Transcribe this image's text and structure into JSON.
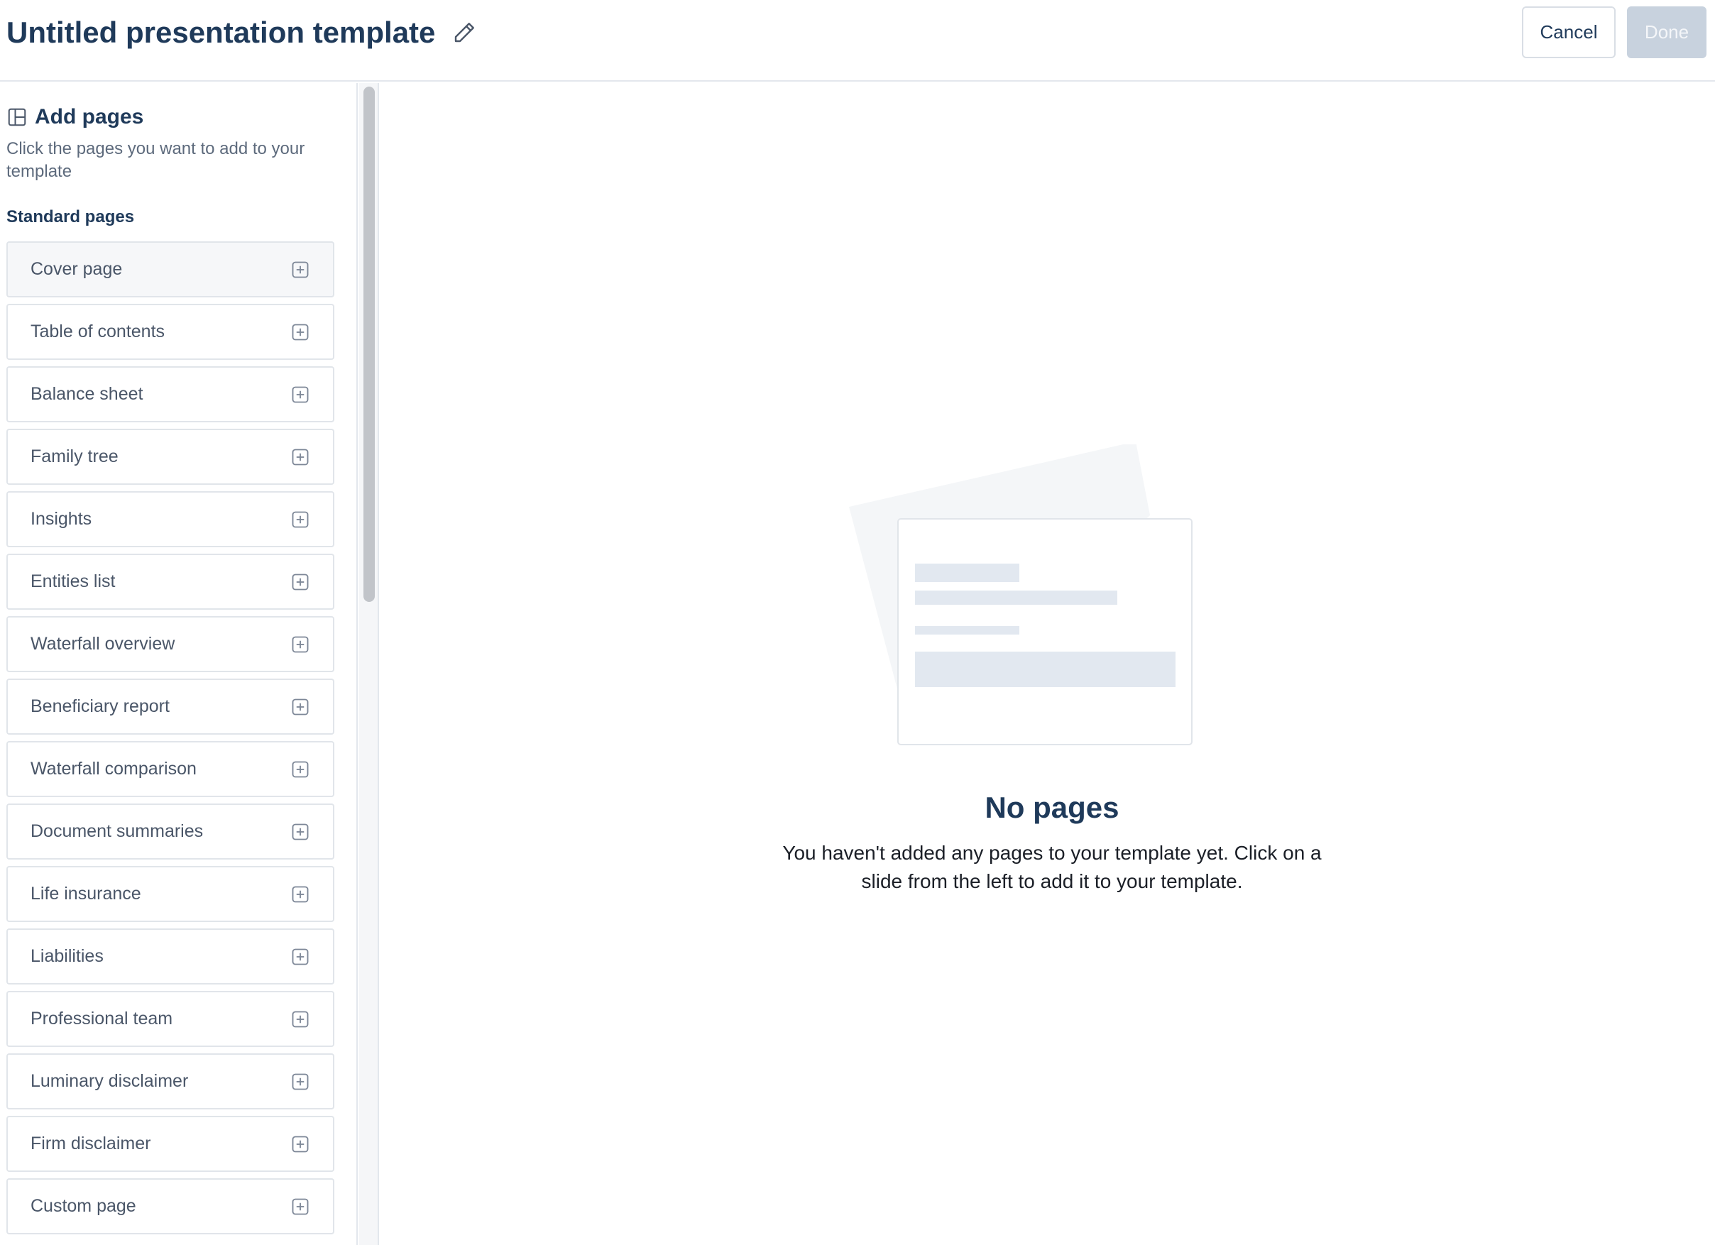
{
  "header": {
    "title": "Untitled presentation template",
    "cancel_label": "Cancel",
    "done_label": "Done"
  },
  "sidebar": {
    "heading": "Add pages",
    "description": "Click the pages you want to add to your template",
    "section_label": "Standard pages",
    "items": [
      {
        "label": "Cover page"
      },
      {
        "label": "Table of contents"
      },
      {
        "label": "Balance sheet"
      },
      {
        "label": "Family tree"
      },
      {
        "label": "Insights"
      },
      {
        "label": "Entities list"
      },
      {
        "label": "Waterfall overview"
      },
      {
        "label": "Beneficiary report"
      },
      {
        "label": "Waterfall comparison"
      },
      {
        "label": "Document summaries"
      },
      {
        "label": "Life insurance"
      },
      {
        "label": "Liabilities"
      },
      {
        "label": "Professional team"
      },
      {
        "label": "Luminary disclaimer"
      },
      {
        "label": "Firm disclaimer"
      },
      {
        "label": "Custom page"
      }
    ]
  },
  "main": {
    "empty_title": "No pages",
    "empty_description": "You haven't added any pages to your template yet. Click on a slide from the left to add it to your template."
  },
  "icons": {
    "edit": "pencil-icon",
    "section": "layout-icon",
    "add": "plus-square-icon"
  },
  "colors": {
    "primary_text": "#1f3a5a",
    "done_disabled": "#c8d2de",
    "border": "#e1e5ea"
  }
}
